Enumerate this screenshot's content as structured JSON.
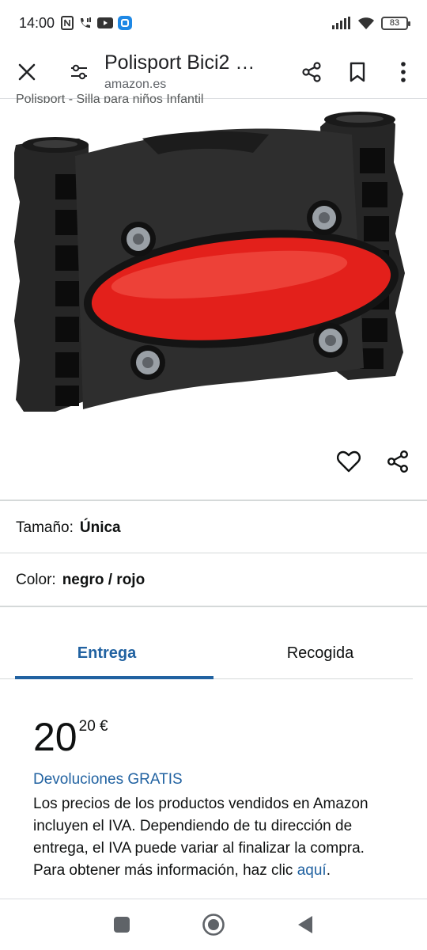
{
  "status_bar": {
    "time": "14:00",
    "battery": "83",
    "left_icons": [
      "nfc-icon",
      "wifi-calling-icon",
      "youtube-icon",
      "app-icon"
    ],
    "right_icons": [
      "signal-icon",
      "wifi-icon",
      "battery-icon"
    ]
  },
  "header": {
    "title": "Polisport Bici2 …",
    "url": "amazon.es",
    "actions": [
      "close-icon",
      "tune-icon",
      "share-icon",
      "bookmark-icon",
      "more-vert-icon"
    ]
  },
  "product": {
    "breadcrumb": "Polisport - Silla para niños Infantil",
    "image_actions": [
      "heart-icon",
      "share-icon"
    ]
  },
  "variations": {
    "size_label": "Tamaño:",
    "size_value": "Única",
    "color_label": "Color:",
    "color_value": "negro / rojo"
  },
  "tabs": [
    {
      "label": "Entrega",
      "active": true
    },
    {
      "label": "Recogida",
      "active": false
    }
  ],
  "price": {
    "whole": "20",
    "fraction": "20 €"
  },
  "returns_link": "Devoluciones GRATIS",
  "tax_info": {
    "text": "Los precios de los productos vendidos en Amazon incluyen el IVA. Dependiendo de tu dirección de entrega, el IVA puede variar al finalizar la compra. Para obtener más información, haz clic",
    "link": "aquí",
    "end": "."
  },
  "colors": {
    "accent_blue": "#2162a1",
    "text": "#0f1111",
    "separator": "#d5d9d9",
    "product_red": "#e3201b",
    "product_black": "#2b2b2b"
  },
  "nav_bar": [
    "recents-square-icon",
    "home-circle-icon",
    "back-triangle-icon"
  ]
}
